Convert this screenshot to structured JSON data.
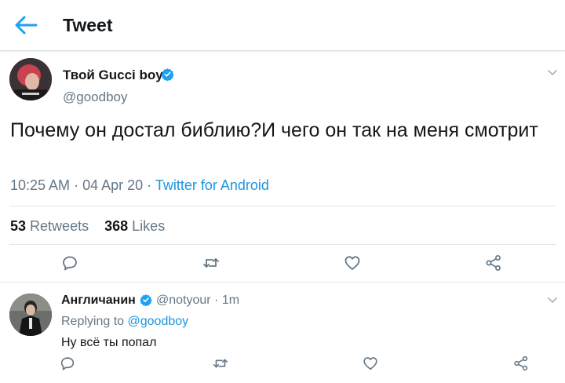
{
  "header": {
    "title": "Tweet",
    "back_icon": "arrow-left-icon",
    "accent": "#1da1f2"
  },
  "tweet": {
    "author_name": "Твой Gucci boy",
    "handle": "@goodboy",
    "verified": true,
    "text": "Почему он достал библию?И чего он так на меня смотрит",
    "time": "10:25 AM",
    "date": "04 Apr 20",
    "source": "Twitter for Android",
    "retweets_count": "53",
    "retweets_label": "Retweets",
    "likes_count": "368",
    "likes_label": "Likes",
    "actions": [
      "reply-icon",
      "retweet-icon",
      "like-icon",
      "share-icon"
    ]
  },
  "reply": {
    "author_name": "Англичанин",
    "handle": "@notyour",
    "time": "1m",
    "verified": true,
    "replying_prefix": "Replying to",
    "replying_to": "@goodboy",
    "text": "Ну всё ты попал"
  },
  "colors": {
    "link": "#1b95e0",
    "muted": "#657786",
    "verified": "#1da1f2"
  }
}
